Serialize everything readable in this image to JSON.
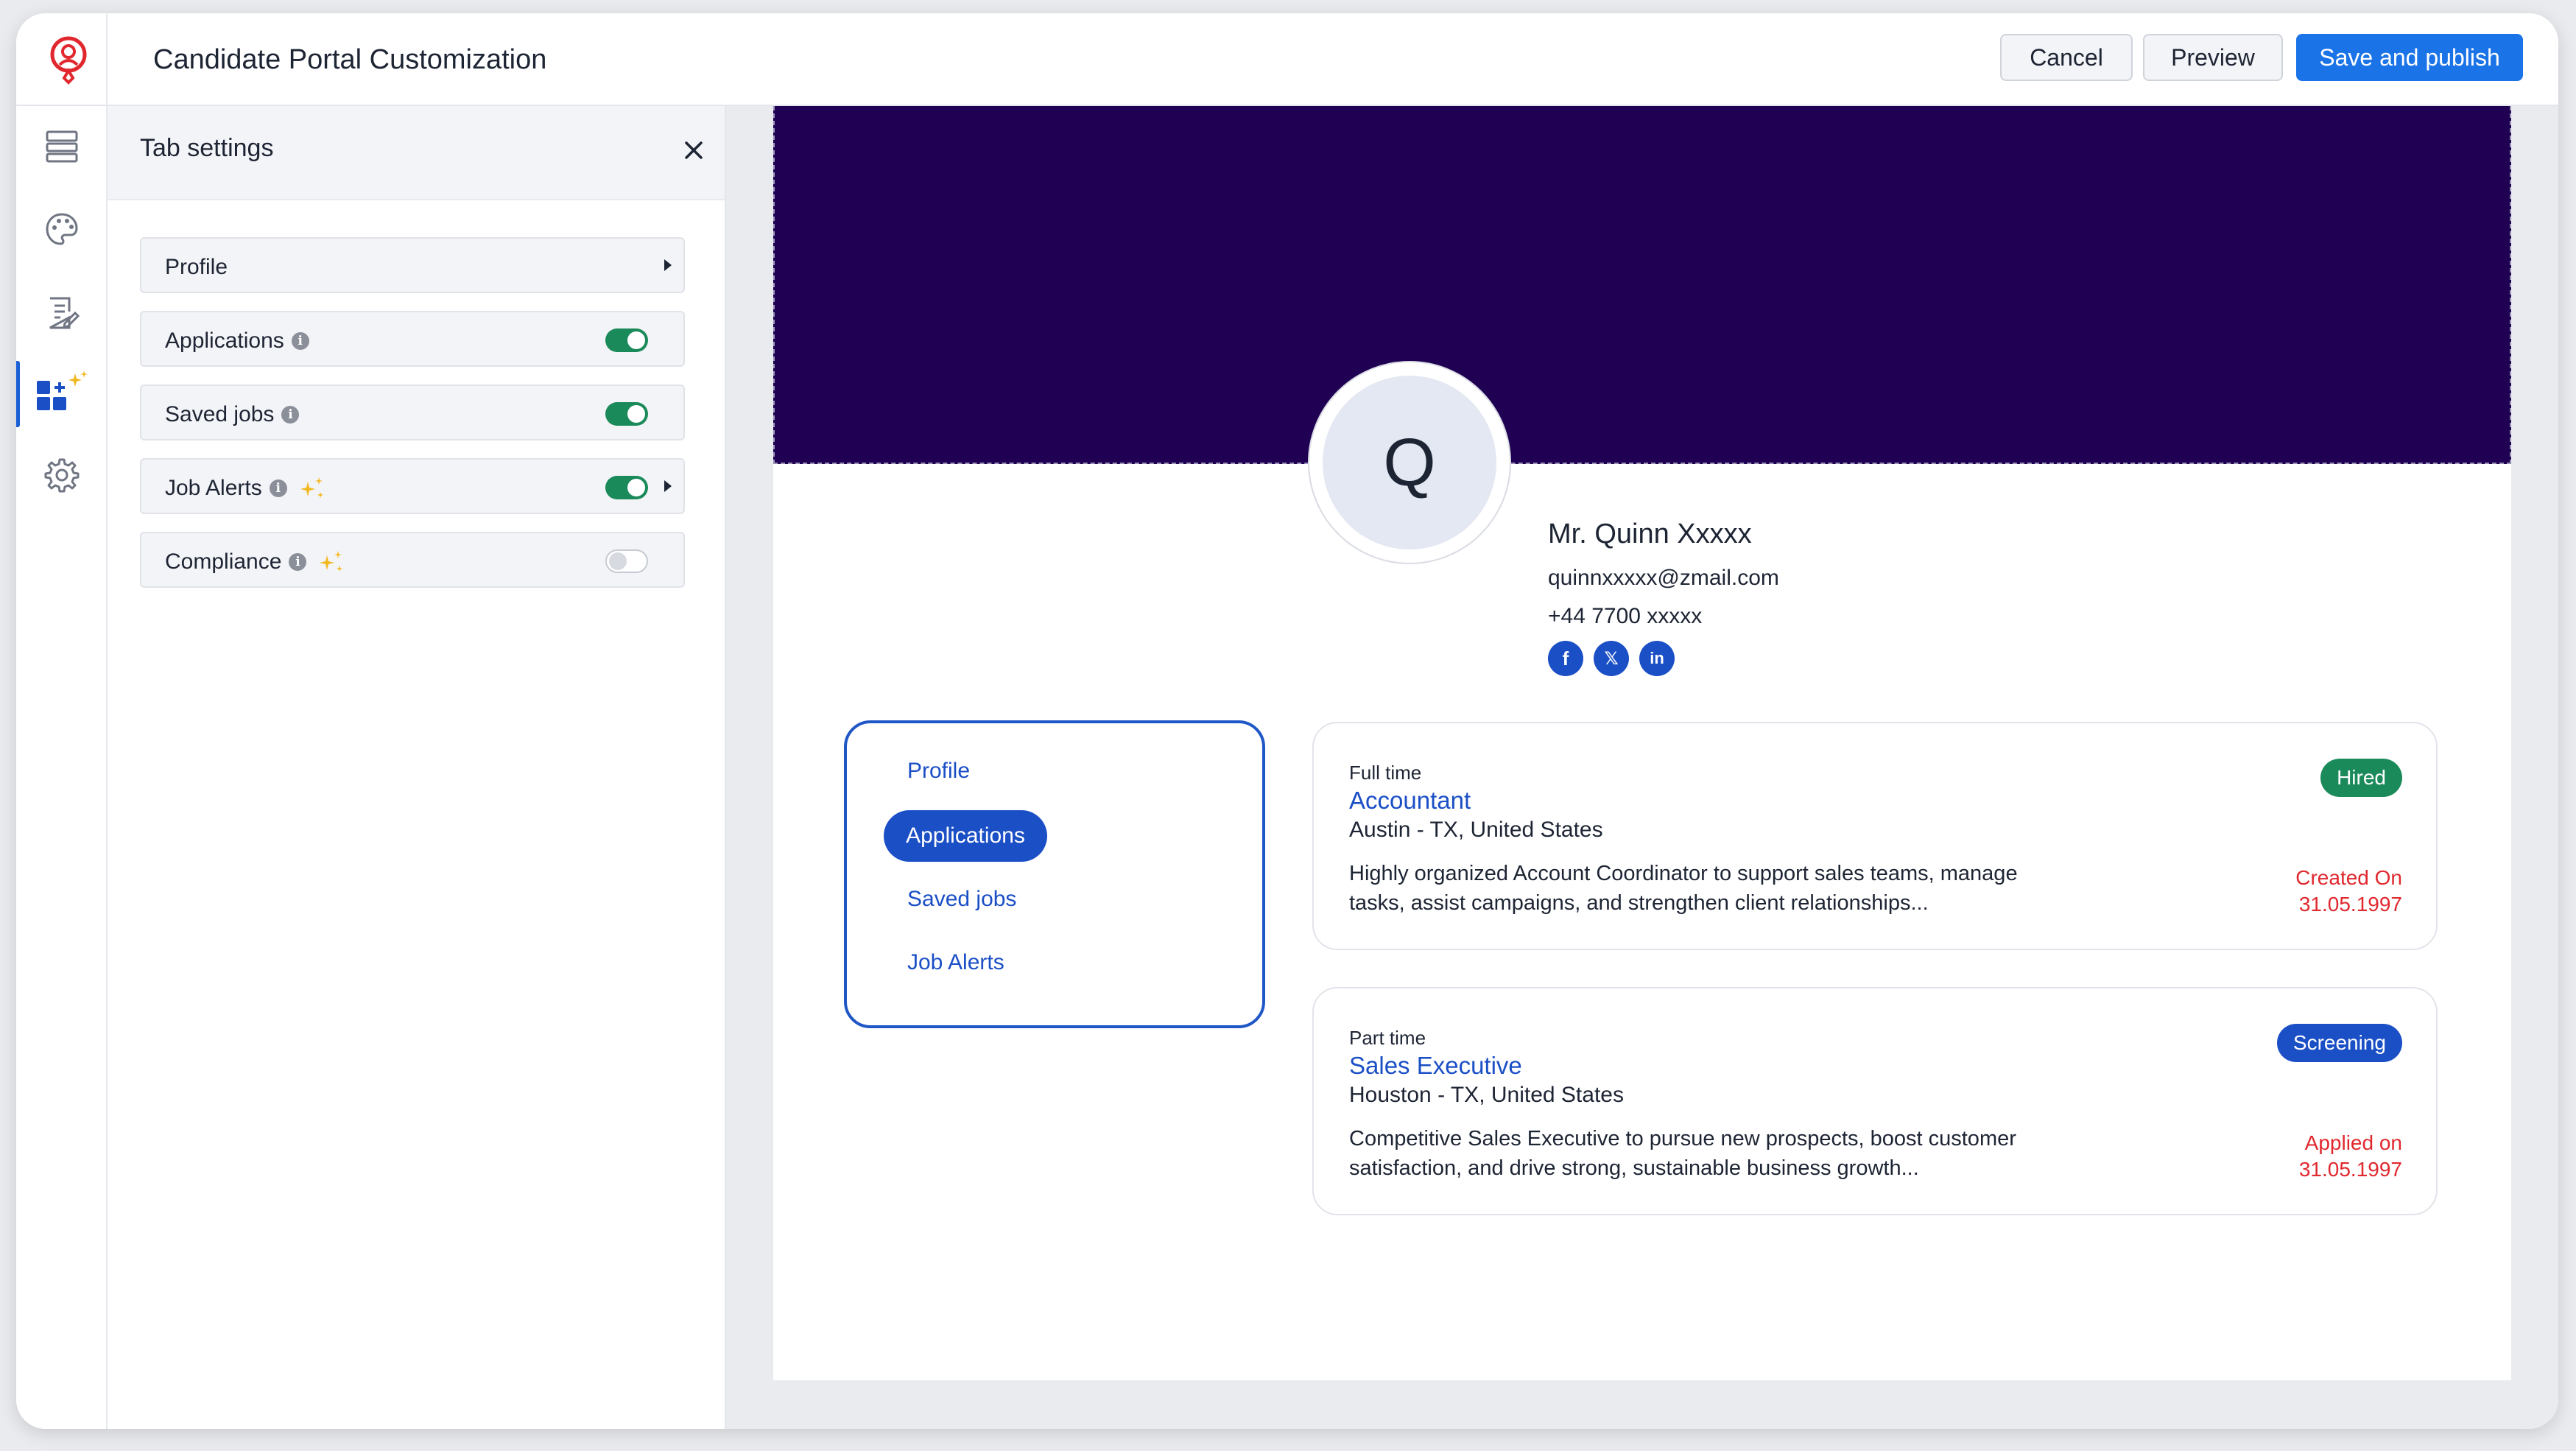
{
  "header": {
    "title": "Candidate Portal Customization",
    "cancel_label": "Cancel",
    "preview_label": "Preview",
    "save_label": "Save and publish"
  },
  "rail": {
    "items": [
      {
        "icon": "layout-rows-icon"
      },
      {
        "icon": "palette-icon"
      },
      {
        "icon": "form-edit-icon"
      },
      {
        "icon": "widgets-sparkle-icon",
        "active": true
      },
      {
        "icon": "gear-icon"
      }
    ]
  },
  "panel": {
    "title": "Tab settings",
    "tabs": [
      {
        "label": "Profile",
        "info": false,
        "sparkle": false,
        "toggle": null,
        "expand": true
      },
      {
        "label": "Applications",
        "info": true,
        "sparkle": false,
        "toggle": true,
        "expand": false
      },
      {
        "label": "Saved jobs",
        "info": true,
        "sparkle": false,
        "toggle": true,
        "expand": false
      },
      {
        "label": "Job Alerts",
        "info": true,
        "sparkle": true,
        "toggle": true,
        "expand": true
      },
      {
        "label": "Compliance",
        "info": true,
        "sparkle": true,
        "toggle": false,
        "expand": false
      }
    ]
  },
  "preview": {
    "banner_color": "#1f0052",
    "avatar_initial": "Q",
    "candidate": {
      "name": "Mr. Quinn Xxxxx",
      "email": "quinnxxxxx@zmail.com",
      "phone": "+44 7700 xxxxx"
    },
    "socials": [
      {
        "name": "facebook-icon",
        "glyph": "f"
      },
      {
        "name": "x-icon",
        "glyph": "𝕏"
      },
      {
        "name": "linkedin-icon",
        "glyph": "in"
      }
    ],
    "nav": {
      "items": [
        "Profile",
        "Applications",
        "Saved jobs",
        "Job Alerts"
      ],
      "active": "Applications"
    },
    "jobs": [
      {
        "type": "Full time",
        "title": "Accountant",
        "location": "Austin - TX, United States",
        "description": "Highly organized Account Coordinator to support sales teams, manage tasks, assist campaigns, and strengthen client relationships...",
        "status": "Hired",
        "date_label": "Created On",
        "date": "31.05.1997"
      },
      {
        "type": "Part time",
        "title": "Sales Executive",
        "location": "Houston - TX, United States",
        "description": "Competitive Sales Executive to pursue new prospects, boost customer satisfaction, and drive strong, sustainable business growth...",
        "status": "Screening",
        "date_label": "Applied on",
        "date": "31.05.1997"
      }
    ]
  },
  "colors": {
    "accent": "#1a74e8",
    "nav_blue": "#1b4fc6",
    "toggle_on": "#1b8a5a",
    "date_red": "#e0282e",
    "logo_red": "#e0282e"
  }
}
